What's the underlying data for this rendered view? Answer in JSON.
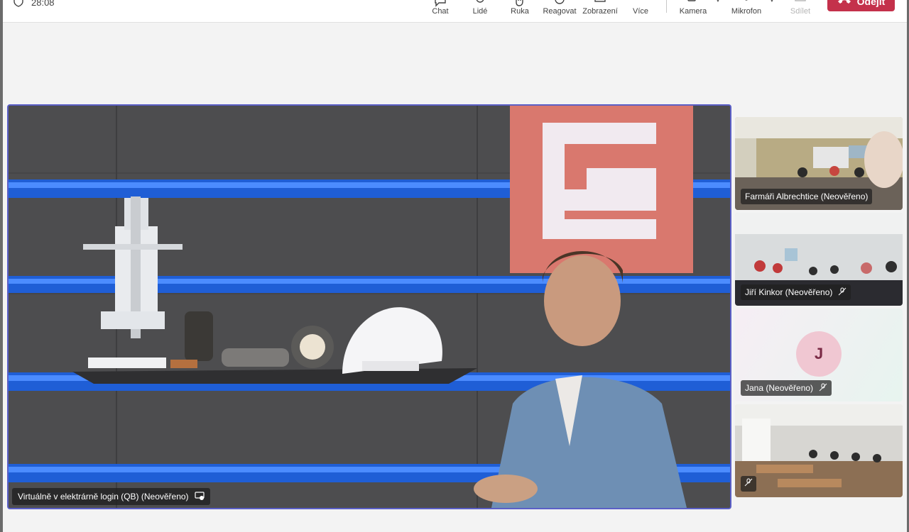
{
  "meeting": {
    "timer": "28:08"
  },
  "toolbar": {
    "chat": "Chat",
    "people": "Lidé",
    "hand": "Ruka",
    "react": "Reagovat",
    "view": "Zobrazení",
    "more": "Více",
    "camera": "Kamera",
    "mic": "Mikrofon",
    "share": "Sdílet",
    "leave": "Odejít"
  },
  "main_video": {
    "name": "Virtuálně v elektrárně login (QB) (Neověřeno)"
  },
  "participants": [
    {
      "name": "Farmáři Albrechtice (Neověřeno)",
      "muted": false
    },
    {
      "name": "Jiří Kinkor (Neověřeno)",
      "muted": true
    },
    {
      "name": "Jana (Neověřeno)",
      "muted": true,
      "initial": "J"
    },
    {
      "name": "",
      "muted": true
    }
  ],
  "colors": {
    "accent": "#5b5fc7",
    "leave": "#c4314b",
    "avatar_bg": "#f0c7d2",
    "avatar_text": "#7a2a45"
  }
}
